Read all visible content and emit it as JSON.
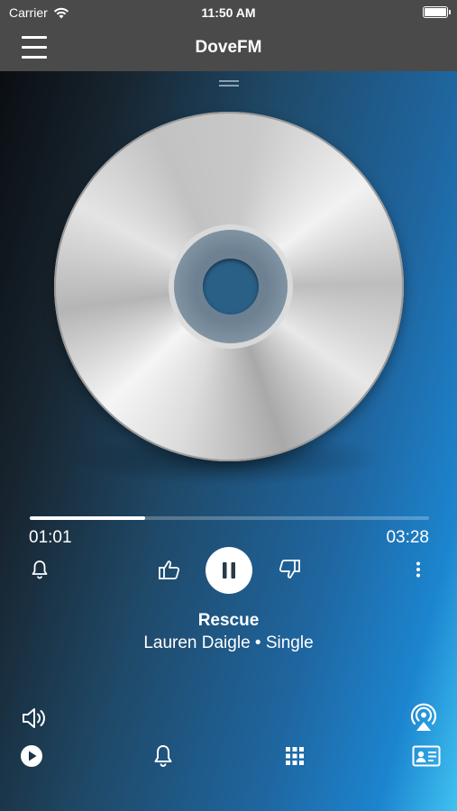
{
  "status_bar": {
    "carrier": "Carrier",
    "time": "11:50 AM"
  },
  "nav": {
    "title": "DoveFM"
  },
  "player": {
    "elapsed": "01:01",
    "total": "03:28",
    "progress": 0.29,
    "track_title": "Rescue",
    "track_subtitle": "Lauren Daigle • Single"
  },
  "icons": {
    "menu": "menu-icon",
    "bell": "bell-icon",
    "thumbs_up": "thumbs-up-icon",
    "pause": "pause-icon",
    "thumbs_down": "thumbs-down-icon",
    "more": "more-vertical-icon",
    "volume": "volume-icon",
    "airplay": "airplay-icon",
    "play": "play-circle-icon",
    "grid": "grid-icon",
    "contact": "contact-card-icon"
  },
  "colors": {
    "bar": "#4a4a4a",
    "accent": "#1c85cf",
    "text": "#ffffff"
  }
}
